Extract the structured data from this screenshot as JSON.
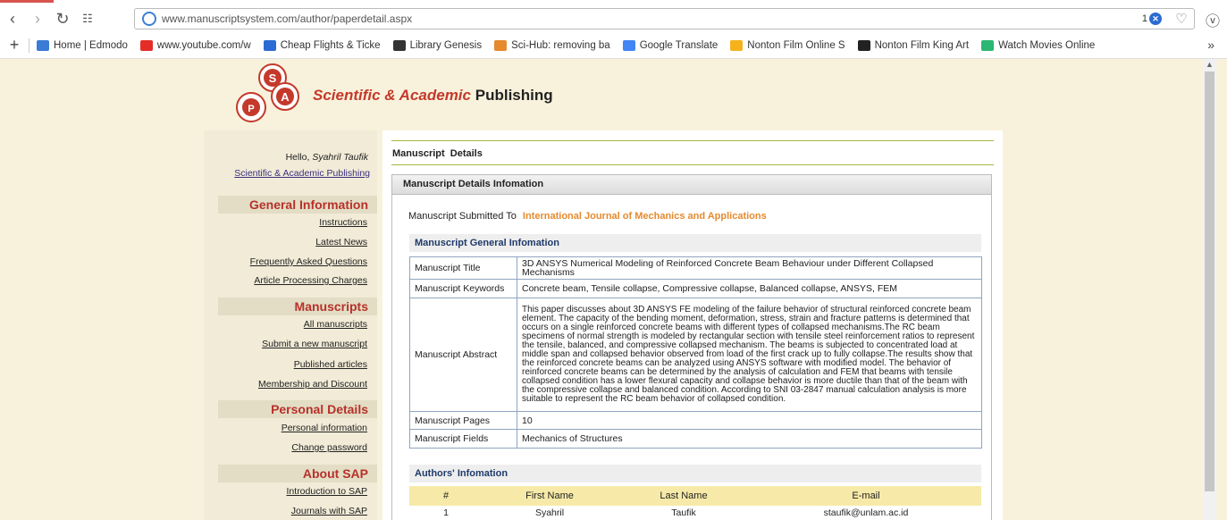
{
  "browser": {
    "url": "www.manuscriptsystem.com/author/paperdetail.aspx",
    "badge_count": "1",
    "bookmarks": [
      {
        "label": "Home | Edmodo",
        "color": "#3a7bd5"
      },
      {
        "label": "www.youtube.com/w",
        "color": "#e52d27"
      },
      {
        "label": "Cheap Flights & Ticke",
        "color": "#2c6bd3"
      },
      {
        "label": "Library Genesis",
        "color": "#333333"
      },
      {
        "label": "Sci-Hub: removing ba",
        "color": "#e58a2d"
      },
      {
        "label": "Google Translate",
        "color": "#4285f4"
      },
      {
        "label": "Nonton Film Online S",
        "color": "#f6b21a"
      },
      {
        "label": "Nonton Film King Art",
        "color": "#222222"
      },
      {
        "label": "Watch Movies Online",
        "color": "#2bb673"
      }
    ]
  },
  "brand": {
    "name": "Scientific & Academic",
    "suffix": "Publishing",
    "logo_letters": [
      "S",
      "A",
      "P"
    ]
  },
  "sidebar": {
    "hello": "Hello,",
    "user": "Syahril Taufik",
    "publisher_link": "Scientific & Academic Publishing",
    "sections": [
      {
        "title": "General Information",
        "links": [
          "Instructions",
          "Latest News",
          "Frequently Asked Questions",
          "Article Processing Charges"
        ]
      },
      {
        "title": "Manuscripts",
        "links": [
          "All manuscripts",
          "Submit a new manuscript",
          "Published articles",
          "Membership and Discount"
        ]
      },
      {
        "title": "Personal Details",
        "links": [
          "Personal information",
          "Change password"
        ]
      },
      {
        "title": "About SAP",
        "links": [
          "Introduction to SAP",
          "Journals with SAP"
        ]
      }
    ]
  },
  "main": {
    "title": "Manuscript  Details",
    "panel_title": "Manuscript Details Infomation",
    "submitted_label": "Manuscript Submitted To",
    "journal": "International Journal of Mechanics and Applications",
    "general_title": "Manuscript General Infomation",
    "rows": [
      {
        "key": "Manuscript Title",
        "value": "3D ANSYS Numerical Modeling of Reinforced Concrete Beam Behaviour under Different Collapsed Mechanisms"
      },
      {
        "key": "Manuscript Keywords",
        "value": "Concrete beam, Tensile collapse, Compressive collapse, Balanced collapse, ANSYS, FEM"
      },
      {
        "key": "Manuscript Abstract",
        "value": "This paper discusses about 3D ANSYS FE modeling of the failure behavior of structural reinforced concrete beam element. The capacity of the bending moment, deformation, stress, strain and fracture patterns is determined that occurs on a single reinforced concrete beams with different types of collapsed mechanisms.The RC beam specimens of normal strength is modeled by rectangular section with tensile steel reinforcement ratios to represent the tensile, balanced, and compressive collapsed mechanism. The beams is subjected to concentrated load at middle span and collapsed behavior observed from load of the first crack up to fully collapse.The results show that the reinforced concrete beams can be analyzed using ANSYS software with modified model. The behavior of reinforced concrete beams can be determined by the analysis of calculation and FEM that beams with tensile collapsed condition has a lower flexural capacity and collapse behavior is more ductile than that of the beam with the compressive collapse and balanced condition. According to SNI 03-2847 manual calculation analysis is more suitable to represent the RC beam behavior of collapsed condition."
      },
      {
        "key": "Manuscript Pages",
        "value": "10"
      },
      {
        "key": "Manuscript Fields",
        "value": "Mechanics of Structures"
      }
    ],
    "authors_title": "Authors' Infomation",
    "author_headers": [
      "#",
      "First Name",
      "Last Name",
      "E-mail"
    ],
    "authors": [
      [
        "1",
        "Syahril",
        "Taufik",
        "staufik@unlam.ac.id"
      ]
    ]
  }
}
